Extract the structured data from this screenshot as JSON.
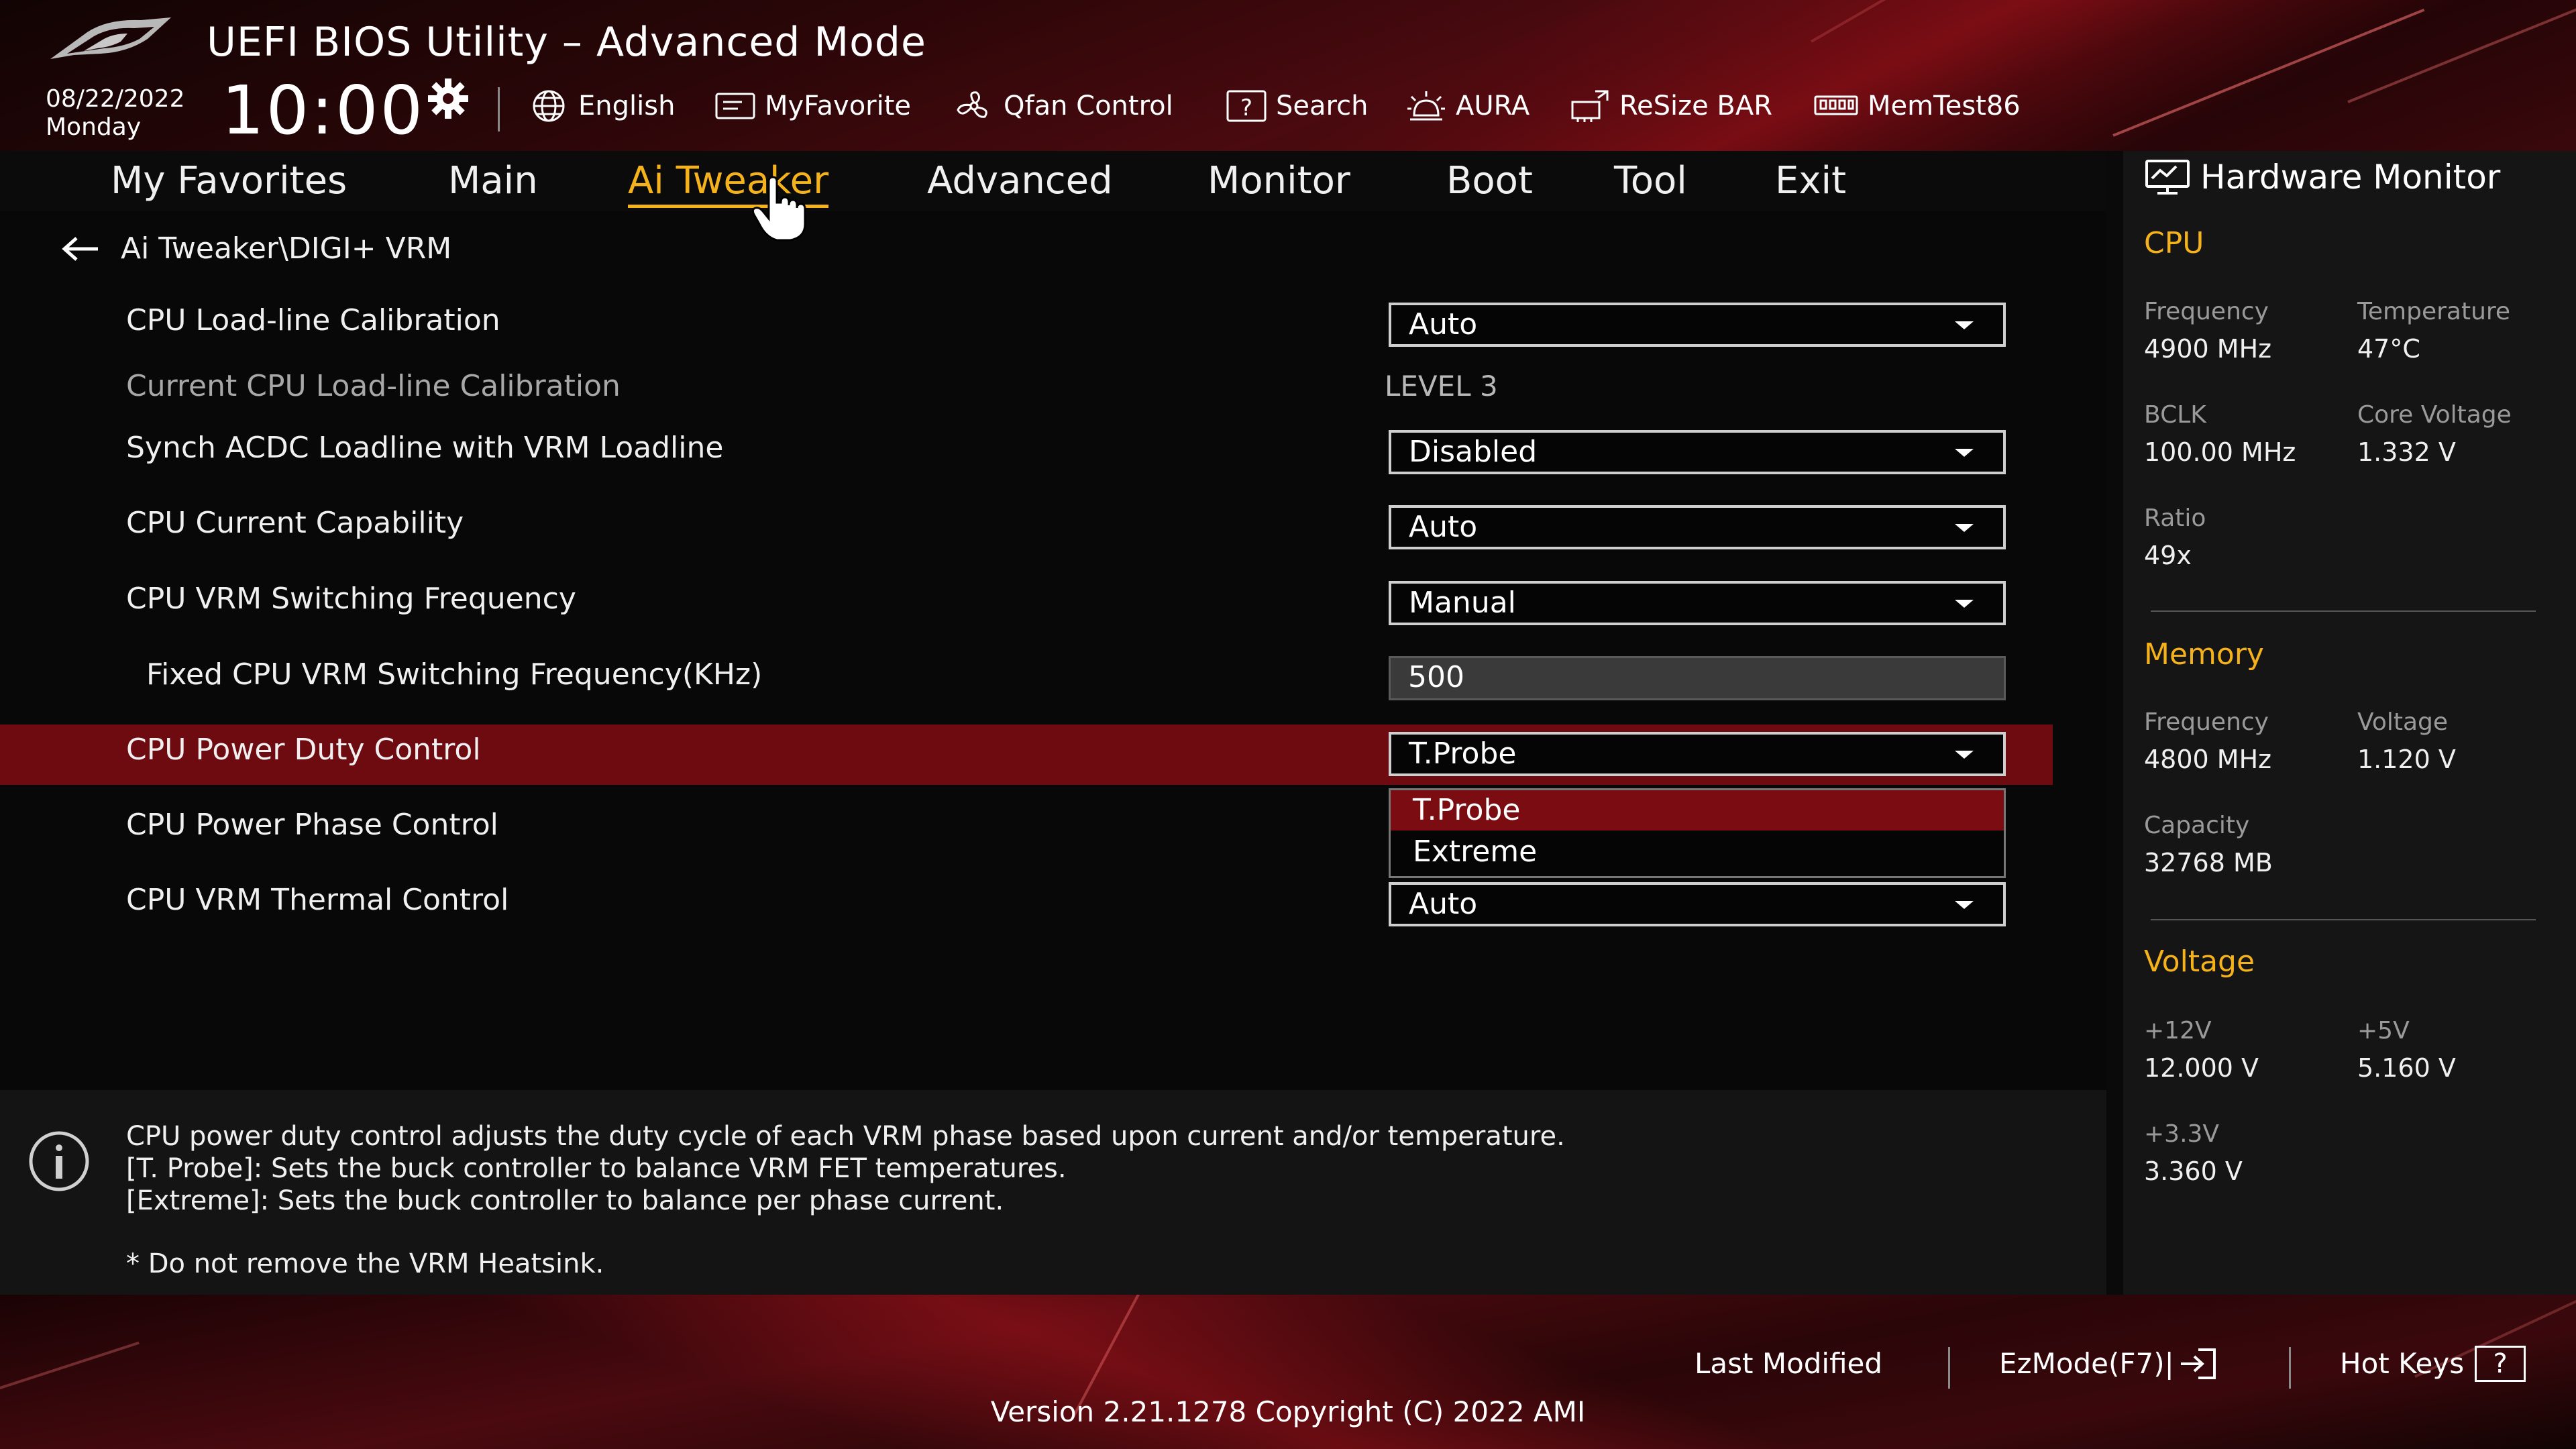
{
  "header": {
    "title": "UEFI BIOS Utility – Advanced Mode",
    "date": "08/22/2022",
    "day": "Monday",
    "time": "10:00",
    "toolbar": [
      {
        "label": "English",
        "icon": "globe-icon"
      },
      {
        "label": "MyFavorite",
        "icon": "favorite-icon"
      },
      {
        "label": "Qfan Control",
        "icon": "fan-icon"
      },
      {
        "label": "Search",
        "icon": "search-icon"
      },
      {
        "label": "AURA",
        "icon": "aura-icon"
      },
      {
        "label": "ReSize BAR",
        "icon": "resize-bar-icon"
      },
      {
        "label": "MemTest86",
        "icon": "memtest-icon"
      }
    ]
  },
  "nav": {
    "tabs": [
      {
        "label": "My Favorites"
      },
      {
        "label": "Main"
      },
      {
        "label": "Ai Tweaker",
        "active": true
      },
      {
        "label": "Advanced"
      },
      {
        "label": "Monitor"
      },
      {
        "label": "Boot"
      },
      {
        "label": "Tool"
      },
      {
        "label": "Exit"
      }
    ]
  },
  "breadcrumb": "Ai Tweaker\\DIGI+ VRM",
  "settings": [
    {
      "label": "CPU Load-line Calibration",
      "value": "Auto",
      "type": "dropdown"
    },
    {
      "label": "Current CPU Load-line Calibration",
      "value": "LEVEL 3",
      "type": "readonly"
    },
    {
      "label": "Synch ACDC Loadline with VRM Loadline",
      "value": "Disabled",
      "type": "dropdown"
    },
    {
      "label": "CPU Current Capability",
      "value": "Auto",
      "type": "dropdown"
    },
    {
      "label": "CPU VRM Switching Frequency",
      "value": "Manual",
      "type": "dropdown"
    },
    {
      "label": "Fixed CPU VRM Switching Frequency(KHz)",
      "value": "500",
      "type": "input"
    },
    {
      "label": "CPU Power Duty Control",
      "value": "T.Probe",
      "type": "dropdown",
      "selected": true
    },
    {
      "label": "CPU Power Phase Control",
      "value": "",
      "type": "dropdown"
    },
    {
      "label": "CPU VRM Thermal Control",
      "value": "Auto",
      "type": "dropdown"
    }
  ],
  "popup_options": [
    "T.Probe",
    "Extreme"
  ],
  "help": {
    "lines": [
      "CPU power duty control adjusts the duty cycle of each VRM phase based upon current and/or temperature.",
      "[T. Probe]: Sets the buck controller to balance VRM FET temperatures.",
      "[Extreme]: Sets the buck controller to balance per phase current.",
      "* Do not remove the VRM Heatsink."
    ]
  },
  "hardware_monitor": {
    "title": "Hardware Monitor",
    "cpu": {
      "heading": "CPU",
      "frequency_label": "Frequency",
      "frequency": "4900 MHz",
      "temperature_label": "Temperature",
      "temperature": "47°C",
      "bclk_label": "BCLK",
      "bclk": "100.00 MHz",
      "core_voltage_label": "Core Voltage",
      "core_voltage": "1.332 V",
      "ratio_label": "Ratio",
      "ratio": "49x"
    },
    "memory": {
      "heading": "Memory",
      "frequency_label": "Frequency",
      "frequency": "4800 MHz",
      "voltage_label": "Voltage",
      "voltage": "1.120 V",
      "capacity_label": "Capacity",
      "capacity": "32768 MB"
    },
    "voltage": {
      "heading": "Voltage",
      "v12_label": "+12V",
      "v12": "12.000 V",
      "v5_label": "+5V",
      "v5": "5.160 V",
      "v33_label": "+3.3V",
      "v33": "3.360 V"
    }
  },
  "footer": {
    "last_modified": "Last Modified",
    "ezmode": "EzMode(F7)|",
    "hotkeys": "Hot Keys",
    "hotkeys_key": "?",
    "version": "Version 2.21.1278 Copyright (C) 2022 AMI"
  },
  "colors": {
    "accent": "#f5b21b",
    "selection": "#6e0b10",
    "header_red": "#4a0a0f"
  }
}
